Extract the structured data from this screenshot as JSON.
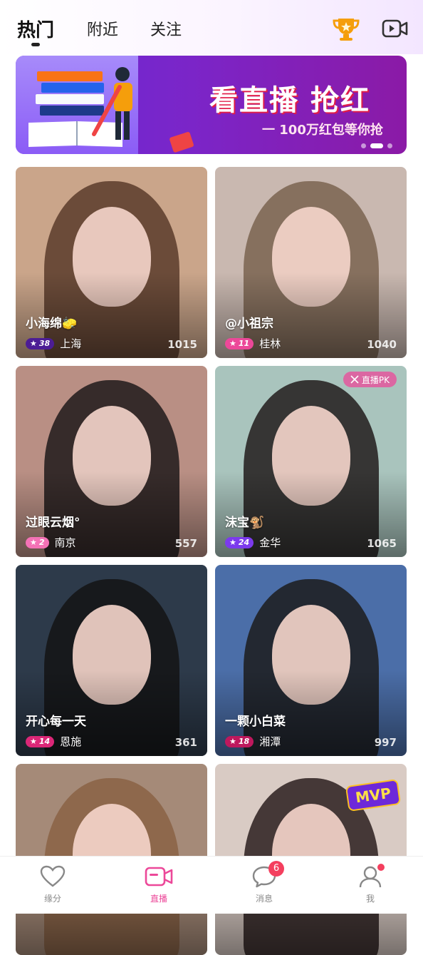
{
  "header": {
    "tabs": [
      {
        "label": "热门",
        "active": true
      },
      {
        "label": "附近",
        "active": false
      },
      {
        "label": "关注",
        "active": false
      }
    ]
  },
  "banner": {
    "title": "看直播 抢红",
    "subtitle": "一 100万红包等你抢",
    "dots": 3,
    "active_dot": 2
  },
  "streams": [
    {
      "name": "小海绵🧽",
      "level": "38",
      "level_color": "#4c1d95",
      "city": "上海",
      "viewers": "1015",
      "bg": "#caa58a",
      "hair": "#5b3b2a"
    },
    {
      "name": "@小祖宗",
      "level": "11",
      "level_color": "#ec4899",
      "city": "桂林",
      "viewers": "1040",
      "bg": "#c9b8b0",
      "hair": "#7a6350"
    },
    {
      "name": "过眼云烟°",
      "level": "2",
      "level_color": "#f472b6",
      "city": "南京",
      "viewers": "557",
      "bg": "#b98f84",
      "hair": "#1f1a1a"
    },
    {
      "name": "沫宝🐒",
      "level": "24",
      "level_color": "#7c3aed",
      "city": "金华",
      "viewers": "1065",
      "bg": "#a9c4bd",
      "hair": "#221c1c",
      "pk": "直播PK"
    },
    {
      "name": "开心每一天",
      "level": "14",
      "level_color": "#db2777",
      "city": "恩施",
      "viewers": "361",
      "bg": "#2d3a4a",
      "hair": "#141414"
    },
    {
      "name": "一颗小白菜",
      "level": "18",
      "level_color": "#be185d",
      "city": "湘潭",
      "viewers": "997",
      "bg": "#4b6ea8",
      "hair": "#1c1c1c"
    },
    {
      "name": "",
      "level": "",
      "level_color": "#ec4899",
      "city": "",
      "viewers": "",
      "bg": "#a58a78",
      "hair": "#8a6244"
    },
    {
      "name": "",
      "level": "",
      "level_color": "#ec4899",
      "city": "",
      "viewers": "",
      "bg": "#d9cbc4",
      "hair": "#2a1f1f",
      "mvp": "MVP"
    }
  ],
  "nav": {
    "items": [
      {
        "label": "缘分",
        "icon": "heart-icon"
      },
      {
        "label": "直播",
        "icon": "video-camera-icon",
        "active": true
      },
      {
        "label": "消息",
        "icon": "chat-bubble-icon",
        "badge": "6"
      },
      {
        "label": "我",
        "icon": "person-icon",
        "dot": true
      }
    ]
  },
  "colors": {
    "accent": "#ec4899",
    "badge": "#f43f5e"
  }
}
